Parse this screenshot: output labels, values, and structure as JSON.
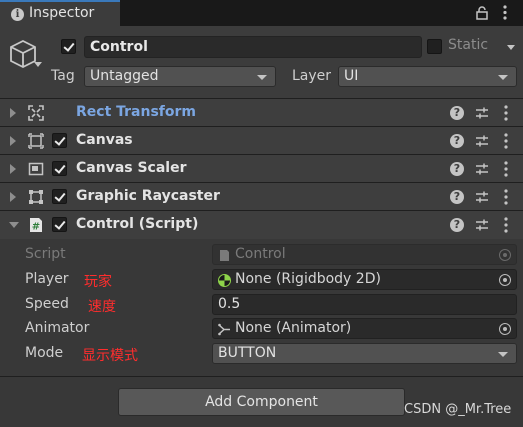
{
  "tab": {
    "icon": "info-icon",
    "label": "Inspector"
  },
  "header": {
    "name": "Control",
    "static_label": "Static",
    "tag_label": "Tag",
    "tag_value": "Untagged",
    "layer_label": "Layer",
    "layer_value": "UI"
  },
  "components": [
    {
      "title": "Rect Transform",
      "icon": "rect-transform-icon",
      "has_checkbox": false,
      "expanded": false,
      "highlight": true
    },
    {
      "title": "Canvas",
      "icon": "canvas-icon",
      "has_checkbox": true,
      "expanded": false
    },
    {
      "title": "Canvas Scaler",
      "icon": "canvas-scaler-icon",
      "has_checkbox": true,
      "expanded": false
    },
    {
      "title": "Graphic Raycaster",
      "icon": "graphic-raycaster-icon",
      "has_checkbox": true,
      "expanded": false
    },
    {
      "title": "Control (Script)",
      "icon": "script-icon",
      "has_checkbox": true,
      "expanded": true
    }
  ],
  "script_fields": {
    "script": {
      "label": "Script",
      "value": "Control"
    },
    "player": {
      "label": "Player",
      "annotation": "玩家",
      "value": "None (Rigidbody 2D)"
    },
    "speed": {
      "label": "Speed",
      "annotation": "速度",
      "value": "0.5"
    },
    "animator": {
      "label": "Animator",
      "value": "None (Animator)"
    },
    "mode": {
      "label": "Mode",
      "annotation": "显示模式",
      "value": "BUTTON"
    }
  },
  "add_component_label": "Add Component",
  "watermark": "CSDN @_Mr.Tree",
  "colors": {
    "accent_blue": "#3a79bb",
    "annotation_red": "#ff2d2d",
    "link_blue": "#7ba6e2"
  }
}
